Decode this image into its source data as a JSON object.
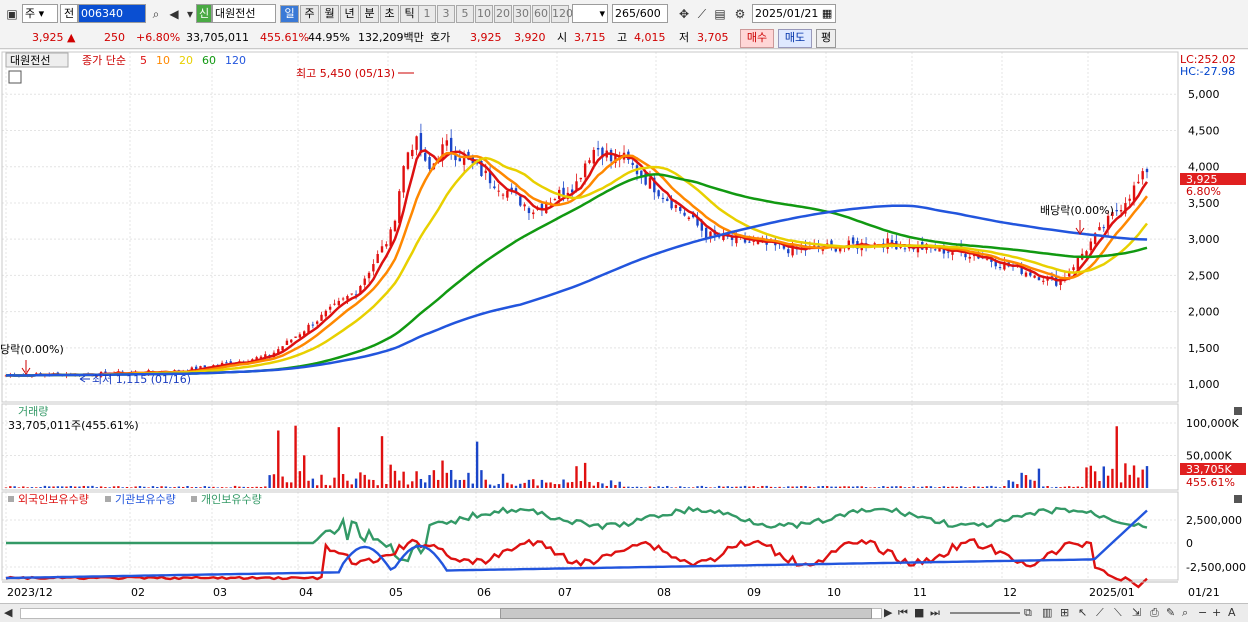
{
  "toolbar": {
    "mode": "주",
    "prev": "전",
    "code": "006340",
    "badge": "신",
    "stock_name": "대원전선",
    "periods": [
      "일",
      "주",
      "월",
      "년",
      "분",
      "초",
      "틱"
    ],
    "intervals": [
      "1",
      "3",
      "5",
      "10",
      "20",
      "30",
      "60",
      "120"
    ],
    "count": "265",
    "count_max": "/600",
    "date": "2025/01/21"
  },
  "quote": {
    "price": "3,925",
    "change": "250",
    "change_pct": "+6.80%",
    "volume": "33,705,011",
    "volume_ratio": "455.61%",
    "turnover": "44.95%",
    "amount": "132,209백만",
    "ask_label": "호가",
    "ask1": "3,925",
    "ask2": "3,920",
    "open_label": "시",
    "open": "3,715",
    "high_label": "고",
    "high": "4,015",
    "low_label": "저",
    "low": "3,705",
    "buy_label": "매수",
    "sell_label": "매도",
    "eval_label": "평"
  },
  "price_panel": {
    "name_box": "대원전선",
    "legend_prefix": "종가 단순",
    "ma_periods": [
      {
        "label": "5",
        "color": "#dd1111"
      },
      {
        "label": "10",
        "color": "#ff8800"
      },
      {
        "label": "20",
        "color": "#e8d000"
      },
      {
        "label": "60",
        "color": "#119911"
      },
      {
        "label": "120",
        "color": "#2255dd"
      }
    ],
    "lc": "LC:252.02",
    "hc": "HC:-27.98",
    "high_annotation": "최고 5,450 (05/13)",
    "low_annotation": "최저 1,115 (01/16)",
    "div_annotation_left": "당락(0.00%)",
    "div_annotation_right": "배당락(0.00%)",
    "last_price_tag": "3,925",
    "last_pct_tag": "6.80%"
  },
  "volume_panel": {
    "title": "거래량",
    "value": "33,705,011주(455.61%)",
    "last_tag": "33,705K",
    "last_pct_tag": "455.61%"
  },
  "holding_panel": {
    "legend": [
      {
        "label": "외국인보유수량",
        "color": "#dd1111"
      },
      {
        "label": "기관보유수량",
        "color": "#2255dd"
      },
      {
        "label": "개인보유수량",
        "color": "#339966"
      }
    ]
  },
  "x_axis": [
    "2023/12",
    "02",
    "03",
    "04",
    "05",
    "06",
    "07",
    "08",
    "09",
    "10",
    "11",
    "12",
    "2025/01"
  ],
  "x_axis_right": "01/21",
  "chart_data": [
    {
      "type": "candlestick",
      "title": "대원전선",
      "y_ticks": [
        1000,
        1500,
        2000,
        2500,
        3000,
        3500,
        4000,
        4500,
        5000
      ],
      "ylim": [
        850,
        5500
      ],
      "monthly_close": [
        {
          "month": "2023/12",
          "close": 1120
        },
        {
          "month": "01",
          "close": 1140
        },
        {
          "month": "02",
          "close": 1180
        },
        {
          "month": "03",
          "close": 1390
        },
        {
          "month": "04",
          "close": 2300
        },
        {
          "month": "05",
          "close": 4300
        },
        {
          "month": "06",
          "close": 3400
        },
        {
          "month": "07",
          "close": 4150
        },
        {
          "month": "08",
          "close": 3050
        },
        {
          "month": "09",
          "close": 2850
        },
        {
          "month": "10",
          "close": 2950
        },
        {
          "month": "11",
          "close": 2800
        },
        {
          "month": "12",
          "close": 2400
        },
        {
          "month": "2025/01",
          "close": 3925
        }
      ],
      "high": {
        "value": 5450,
        "date": "05/13"
      },
      "low": {
        "value": 1115,
        "date": "01/16"
      },
      "last": 3925
    },
    {
      "type": "bar",
      "title": "거래량",
      "y_ticks": [
        "50,000K",
        "100,000K"
      ],
      "last": 33705011
    },
    {
      "type": "line",
      "y_ticks": [
        "-2,500,000",
        "0",
        "2,500,000"
      ],
      "series": [
        {
          "name": "외국인보유수량"
        },
        {
          "name": "기관보유수량"
        },
        {
          "name": "개인보유수량"
        }
      ]
    }
  ]
}
